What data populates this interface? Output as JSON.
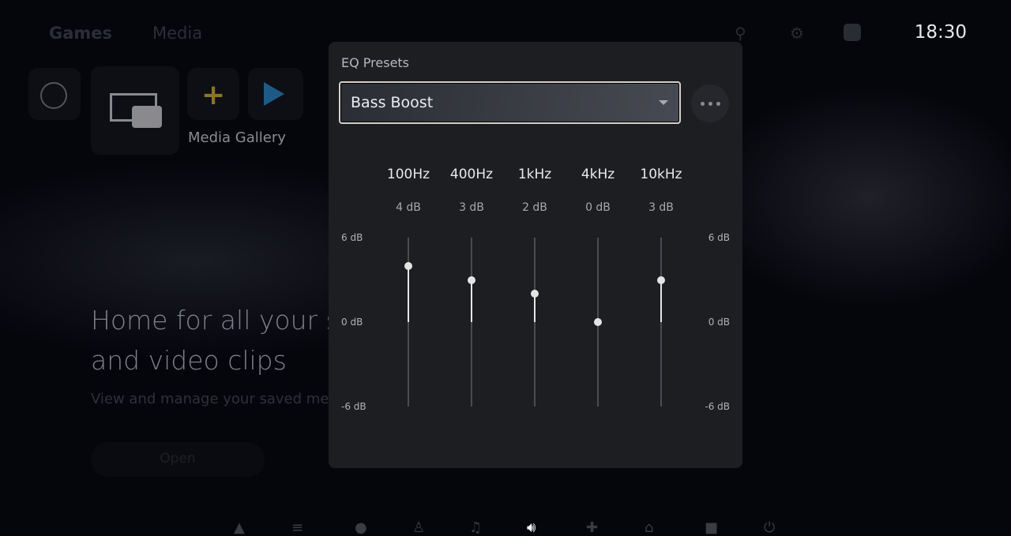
{
  "header": {
    "tabs": [
      "Games",
      "Media"
    ],
    "clock": "18:30",
    "icons": [
      "search-icon",
      "gear-icon",
      "avatar-icon"
    ]
  },
  "home": {
    "tile_label": "Media Gallery",
    "headline_1": "Home for all your s",
    "headline_2": "and video clips",
    "subtitle": "View and manage your saved me",
    "open_button": "Open"
  },
  "eq": {
    "presets_label": "EQ Presets",
    "preset_selected": "Bass Boost",
    "axis": {
      "top": "6 dB",
      "mid": "0 dB",
      "bottom": "-6 dB"
    },
    "range_db": [
      -6,
      6
    ],
    "bands": [
      {
        "freq": "100Hz",
        "label": "4 dB",
        "value": 4
      },
      {
        "freq": "400Hz",
        "label": "3 dB",
        "value": 3
      },
      {
        "freq": "1kHz",
        "label": "2 dB",
        "value": 2
      },
      {
        "freq": "4kHz",
        "label": "0 dB",
        "value": 0
      },
      {
        "freq": "10kHz",
        "label": "3 dB",
        "value": 3
      }
    ]
  },
  "control_center": {
    "active": "sound-icon"
  }
}
